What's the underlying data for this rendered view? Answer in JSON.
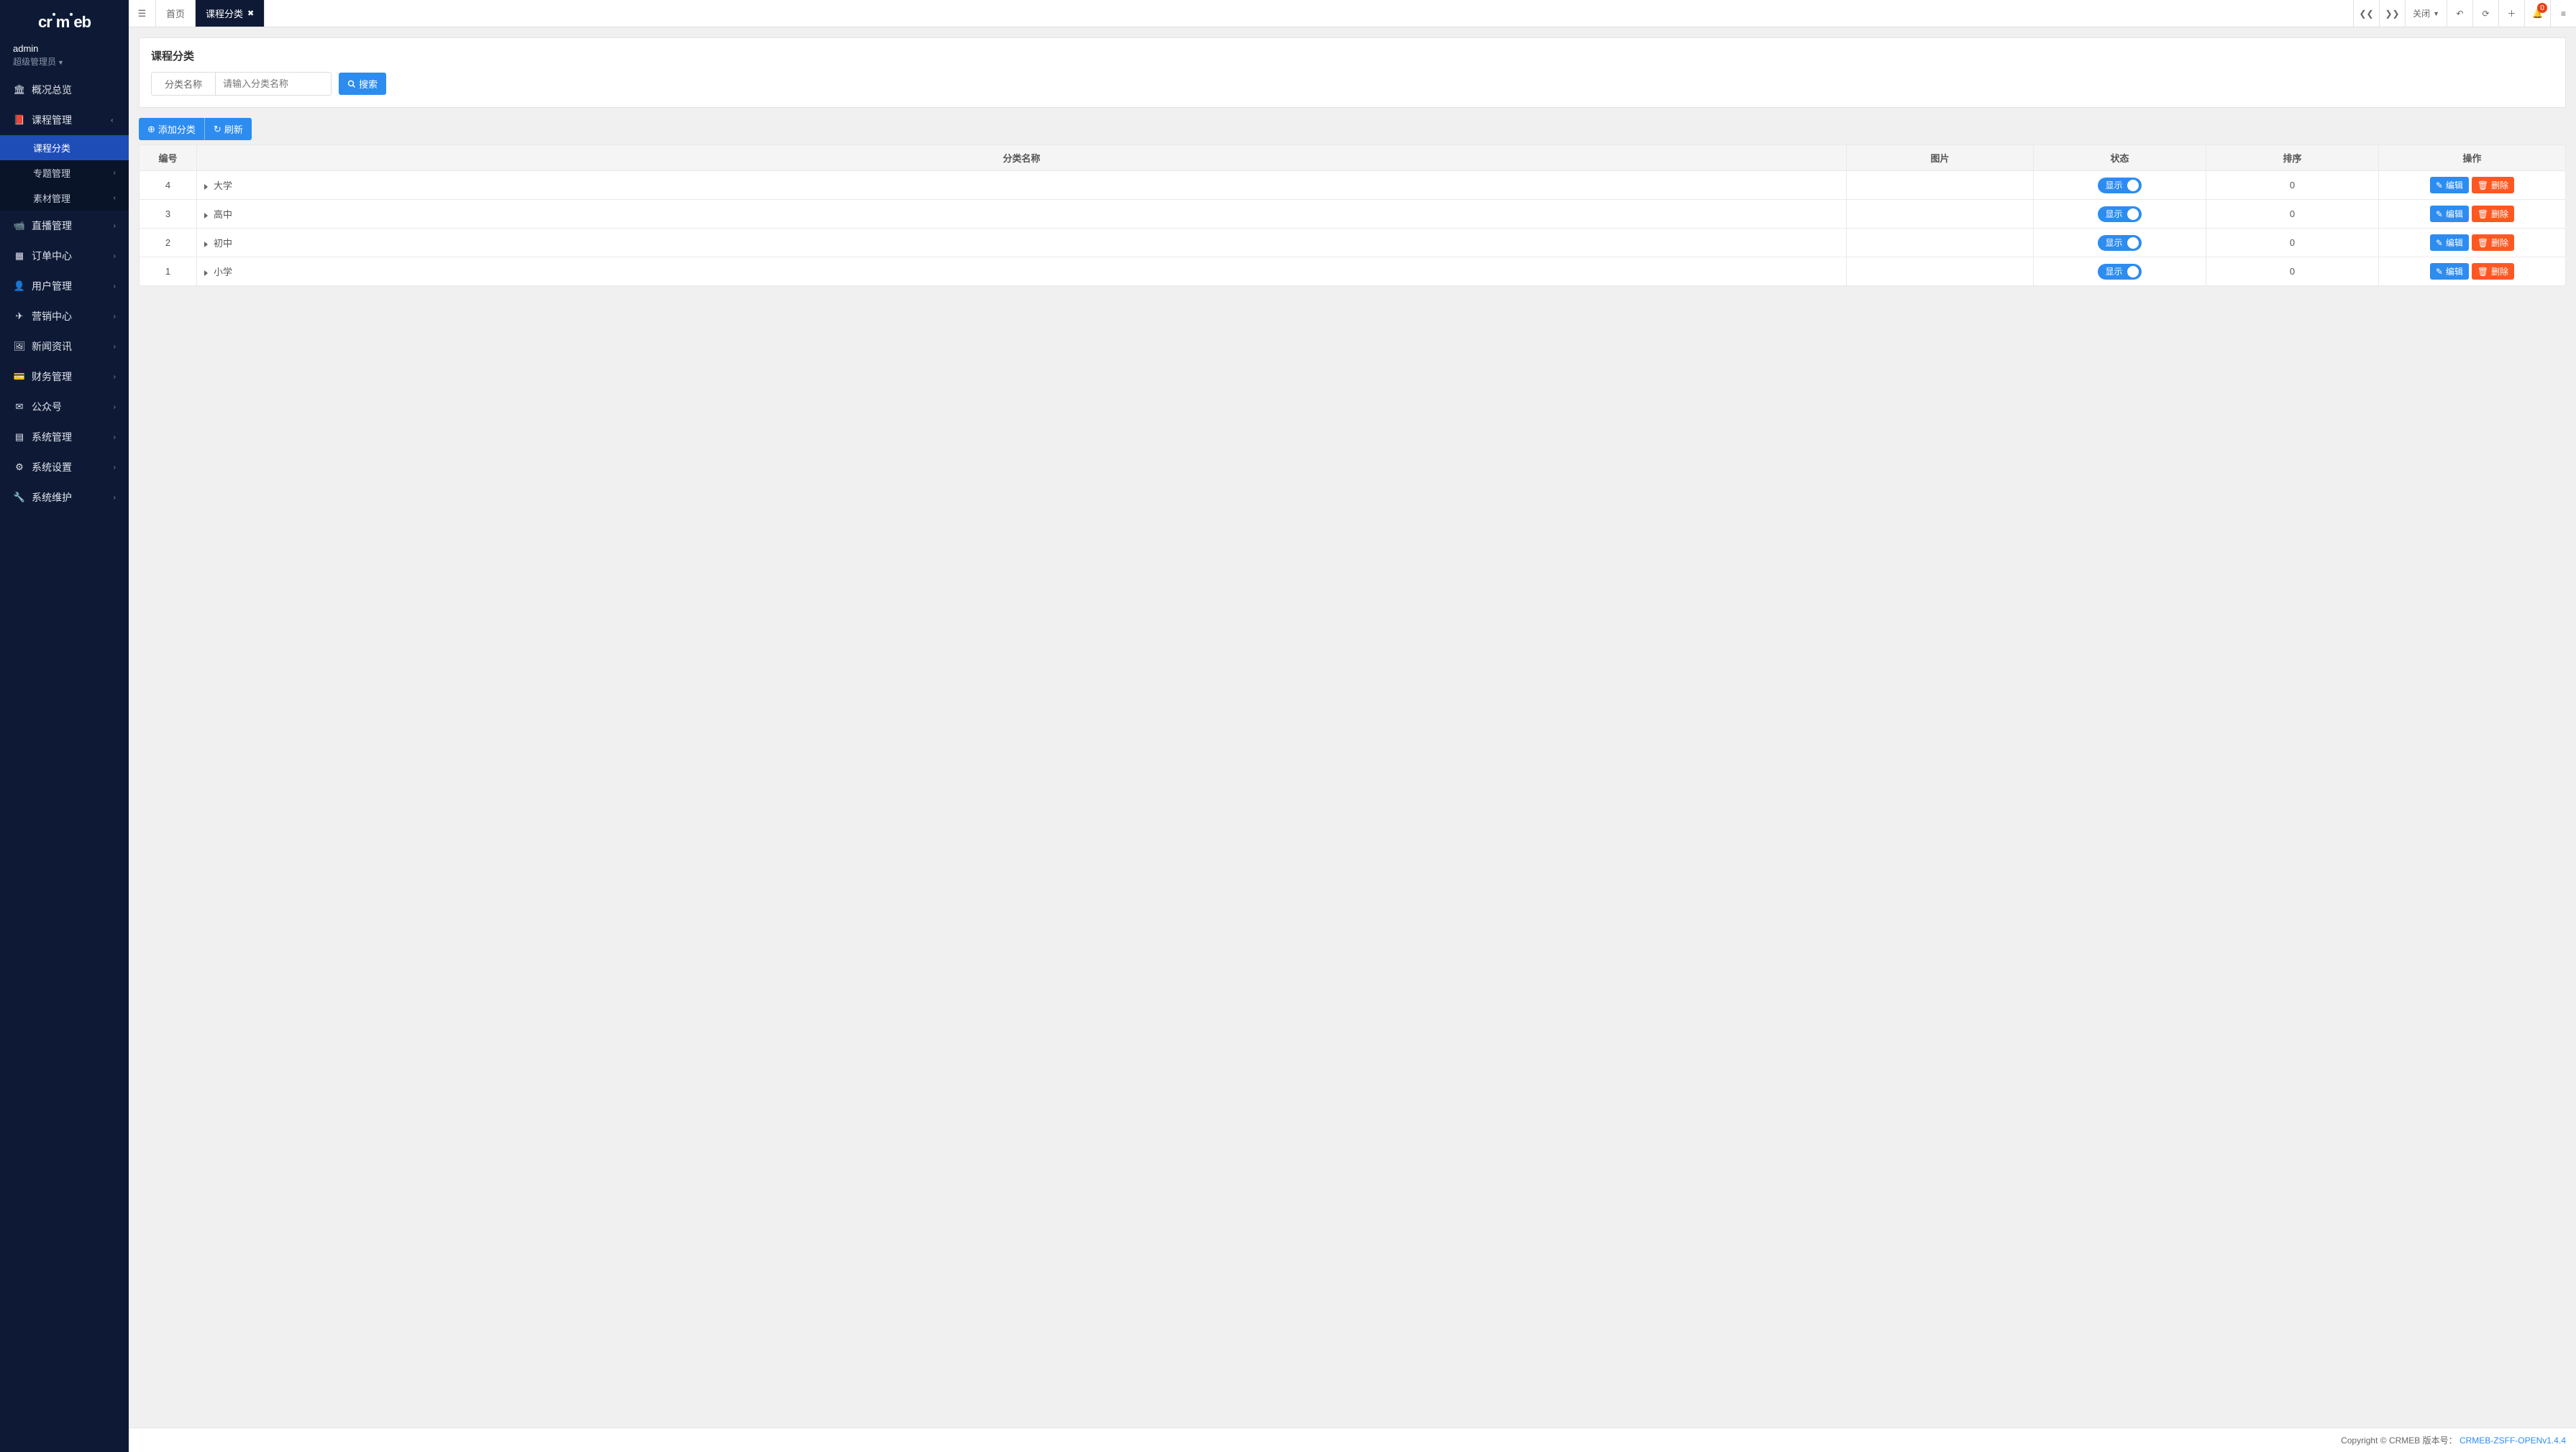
{
  "brand": "crmeb",
  "user": {
    "name": "admin",
    "role": "超级管理员"
  },
  "sidebar": {
    "items": [
      {
        "icon": "overview",
        "label": "概况总览",
        "expandable": false
      },
      {
        "icon": "course",
        "label": "课程管理",
        "expandable": true,
        "open": true,
        "children": [
          {
            "label": "课程分类",
            "active": true
          },
          {
            "label": "专题管理",
            "expandable": true
          },
          {
            "label": "素材管理",
            "expandable": true
          }
        ]
      },
      {
        "icon": "live",
        "label": "直播管理",
        "expandable": true
      },
      {
        "icon": "order",
        "label": "订单中心",
        "expandable": true
      },
      {
        "icon": "user",
        "label": "用户管理",
        "expandable": true
      },
      {
        "icon": "marketing",
        "label": "营销中心",
        "expandable": true
      },
      {
        "icon": "news",
        "label": "新闻资讯",
        "expandable": true
      },
      {
        "icon": "finance",
        "label": "财务管理",
        "expandable": true
      },
      {
        "icon": "wechat",
        "label": "公众号",
        "expandable": true
      },
      {
        "icon": "system",
        "label": "系统管理",
        "expandable": true
      },
      {
        "icon": "settings",
        "label": "系统设置",
        "expandable": true
      },
      {
        "icon": "maintain",
        "label": "系统维护",
        "expandable": true
      }
    ]
  },
  "tabs": [
    {
      "label": "首页",
      "closable": false,
      "active": false
    },
    {
      "label": "课程分类",
      "closable": true,
      "active": true
    }
  ],
  "top_right": {
    "close_label": "关闭",
    "notify_count": "0"
  },
  "page": {
    "title": "课程分类",
    "filter_label": "分类名称",
    "filter_placeholder": "请输入分类名称",
    "search_btn": "搜索",
    "add_btn": "添加分类",
    "refresh_btn": "刷新"
  },
  "table": {
    "headers": {
      "id": "编号",
      "name": "分类名称",
      "image": "图片",
      "status": "状态",
      "sort": "排序",
      "ops": "操作"
    },
    "status_on_label": "显示",
    "edit_label": "编辑",
    "delete_label": "删除",
    "rows": [
      {
        "id": "4",
        "name": "大学",
        "status_on": true,
        "sort": "0"
      },
      {
        "id": "3",
        "name": "高中",
        "status_on": true,
        "sort": "0"
      },
      {
        "id": "2",
        "name": "初中",
        "status_on": true,
        "sort": "0"
      },
      {
        "id": "1",
        "name": "小学",
        "status_on": true,
        "sort": "0"
      }
    ]
  },
  "footer": {
    "copyright": "Copyright © CRMEB 版本号：",
    "version": "CRMEB-ZSFF-OPENv1.4.4"
  }
}
